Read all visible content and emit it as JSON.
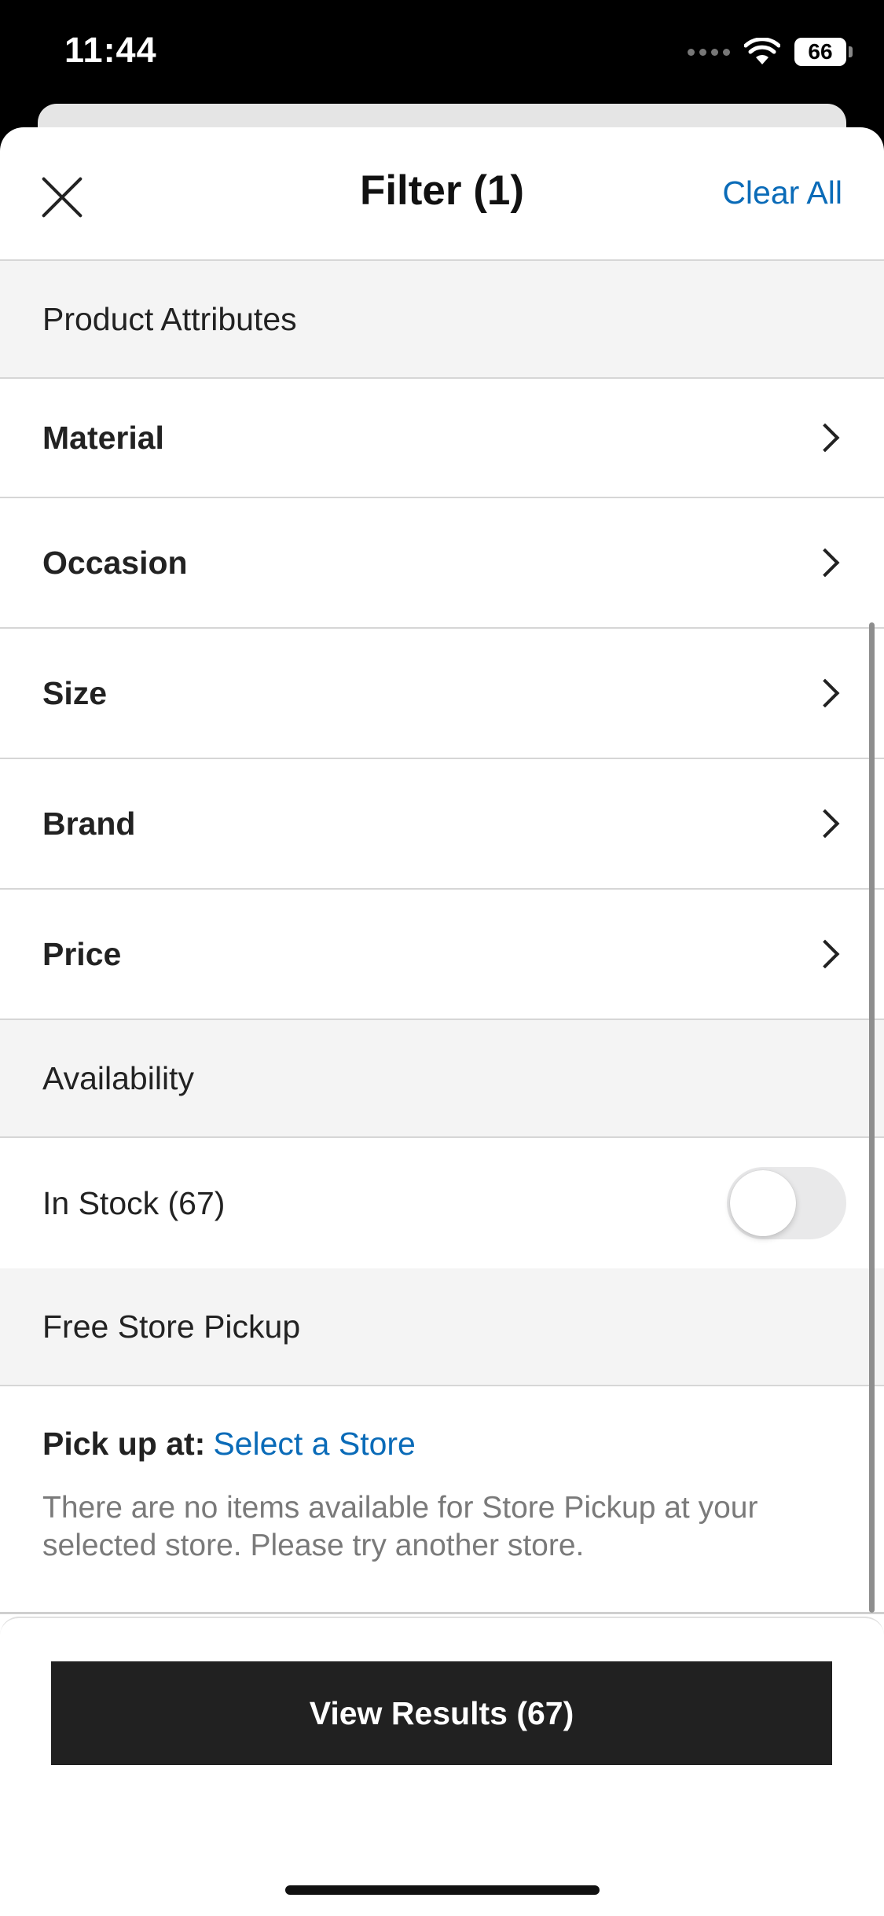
{
  "status_bar": {
    "time": "11:44",
    "battery": "66"
  },
  "header": {
    "title": "Filter (1)",
    "clear_all": "Clear All"
  },
  "sections": {
    "product_attributes": "Product Attributes",
    "availability": "Availability",
    "free_store_pickup": "Free Store Pickup"
  },
  "attributes": [
    "Material",
    "Occasion",
    "Size",
    "Brand",
    "Price"
  ],
  "in_stock": {
    "label": "In Stock (67)",
    "enabled": false
  },
  "pickup": {
    "label": "Pick up at:",
    "link": "Select a Store",
    "message": "There are no items available for Store Pickup at your selected store. Please try another store."
  },
  "footer": {
    "view_results": "View Results (67)"
  }
}
